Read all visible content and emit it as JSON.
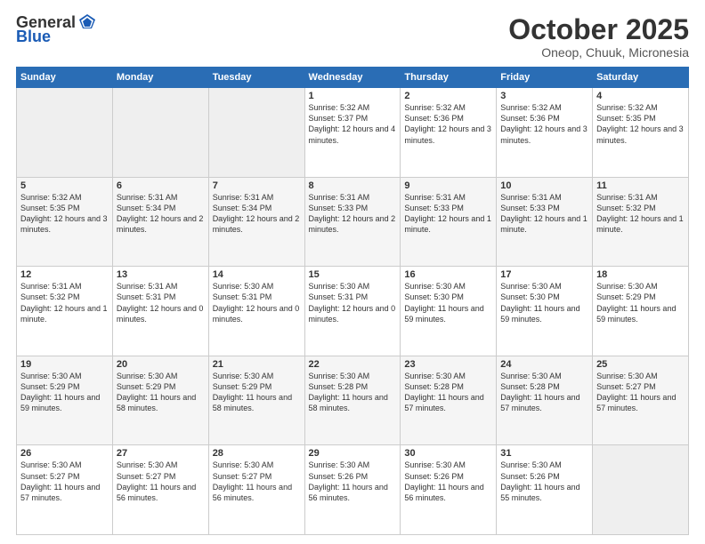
{
  "header": {
    "logo_general": "General",
    "logo_blue": "Blue",
    "month": "October 2025",
    "location": "Oneop, Chuuk, Micronesia"
  },
  "weekdays": [
    "Sunday",
    "Monday",
    "Tuesday",
    "Wednesday",
    "Thursday",
    "Friday",
    "Saturday"
  ],
  "weeks": [
    [
      {
        "day": "",
        "sunrise": "",
        "sunset": "",
        "daylight": ""
      },
      {
        "day": "",
        "sunrise": "",
        "sunset": "",
        "daylight": ""
      },
      {
        "day": "",
        "sunrise": "",
        "sunset": "",
        "daylight": ""
      },
      {
        "day": "1",
        "sunrise": "Sunrise: 5:32 AM",
        "sunset": "Sunset: 5:37 PM",
        "daylight": "Daylight: 12 hours and 4 minutes."
      },
      {
        "day": "2",
        "sunrise": "Sunrise: 5:32 AM",
        "sunset": "Sunset: 5:36 PM",
        "daylight": "Daylight: 12 hours and 3 minutes."
      },
      {
        "day": "3",
        "sunrise": "Sunrise: 5:32 AM",
        "sunset": "Sunset: 5:36 PM",
        "daylight": "Daylight: 12 hours and 3 minutes."
      },
      {
        "day": "4",
        "sunrise": "Sunrise: 5:32 AM",
        "sunset": "Sunset: 5:35 PM",
        "daylight": "Daylight: 12 hours and 3 minutes."
      }
    ],
    [
      {
        "day": "5",
        "sunrise": "Sunrise: 5:32 AM",
        "sunset": "Sunset: 5:35 PM",
        "daylight": "Daylight: 12 hours and 3 minutes."
      },
      {
        "day": "6",
        "sunrise": "Sunrise: 5:31 AM",
        "sunset": "Sunset: 5:34 PM",
        "daylight": "Daylight: 12 hours and 2 minutes."
      },
      {
        "day": "7",
        "sunrise": "Sunrise: 5:31 AM",
        "sunset": "Sunset: 5:34 PM",
        "daylight": "Daylight: 12 hours and 2 minutes."
      },
      {
        "day": "8",
        "sunrise": "Sunrise: 5:31 AM",
        "sunset": "Sunset: 5:33 PM",
        "daylight": "Daylight: 12 hours and 2 minutes."
      },
      {
        "day": "9",
        "sunrise": "Sunrise: 5:31 AM",
        "sunset": "Sunset: 5:33 PM",
        "daylight": "Daylight: 12 hours and 1 minute."
      },
      {
        "day": "10",
        "sunrise": "Sunrise: 5:31 AM",
        "sunset": "Sunset: 5:33 PM",
        "daylight": "Daylight: 12 hours and 1 minute."
      },
      {
        "day": "11",
        "sunrise": "Sunrise: 5:31 AM",
        "sunset": "Sunset: 5:32 PM",
        "daylight": "Daylight: 12 hours and 1 minute."
      }
    ],
    [
      {
        "day": "12",
        "sunrise": "Sunrise: 5:31 AM",
        "sunset": "Sunset: 5:32 PM",
        "daylight": "Daylight: 12 hours and 1 minute."
      },
      {
        "day": "13",
        "sunrise": "Sunrise: 5:31 AM",
        "sunset": "Sunset: 5:31 PM",
        "daylight": "Daylight: 12 hours and 0 minutes."
      },
      {
        "day": "14",
        "sunrise": "Sunrise: 5:30 AM",
        "sunset": "Sunset: 5:31 PM",
        "daylight": "Daylight: 12 hours and 0 minutes."
      },
      {
        "day": "15",
        "sunrise": "Sunrise: 5:30 AM",
        "sunset": "Sunset: 5:31 PM",
        "daylight": "Daylight: 12 hours and 0 minutes."
      },
      {
        "day": "16",
        "sunrise": "Sunrise: 5:30 AM",
        "sunset": "Sunset: 5:30 PM",
        "daylight": "Daylight: 11 hours and 59 minutes."
      },
      {
        "day": "17",
        "sunrise": "Sunrise: 5:30 AM",
        "sunset": "Sunset: 5:30 PM",
        "daylight": "Daylight: 11 hours and 59 minutes."
      },
      {
        "day": "18",
        "sunrise": "Sunrise: 5:30 AM",
        "sunset": "Sunset: 5:29 PM",
        "daylight": "Daylight: 11 hours and 59 minutes."
      }
    ],
    [
      {
        "day": "19",
        "sunrise": "Sunrise: 5:30 AM",
        "sunset": "Sunset: 5:29 PM",
        "daylight": "Daylight: 11 hours and 59 minutes."
      },
      {
        "day": "20",
        "sunrise": "Sunrise: 5:30 AM",
        "sunset": "Sunset: 5:29 PM",
        "daylight": "Daylight: 11 hours and 58 minutes."
      },
      {
        "day": "21",
        "sunrise": "Sunrise: 5:30 AM",
        "sunset": "Sunset: 5:29 PM",
        "daylight": "Daylight: 11 hours and 58 minutes."
      },
      {
        "day": "22",
        "sunrise": "Sunrise: 5:30 AM",
        "sunset": "Sunset: 5:28 PM",
        "daylight": "Daylight: 11 hours and 58 minutes."
      },
      {
        "day": "23",
        "sunrise": "Sunrise: 5:30 AM",
        "sunset": "Sunset: 5:28 PM",
        "daylight": "Daylight: 11 hours and 57 minutes."
      },
      {
        "day": "24",
        "sunrise": "Sunrise: 5:30 AM",
        "sunset": "Sunset: 5:28 PM",
        "daylight": "Daylight: 11 hours and 57 minutes."
      },
      {
        "day": "25",
        "sunrise": "Sunrise: 5:30 AM",
        "sunset": "Sunset: 5:27 PM",
        "daylight": "Daylight: 11 hours and 57 minutes."
      }
    ],
    [
      {
        "day": "26",
        "sunrise": "Sunrise: 5:30 AM",
        "sunset": "Sunset: 5:27 PM",
        "daylight": "Daylight: 11 hours and 57 minutes."
      },
      {
        "day": "27",
        "sunrise": "Sunrise: 5:30 AM",
        "sunset": "Sunset: 5:27 PM",
        "daylight": "Daylight: 11 hours and 56 minutes."
      },
      {
        "day": "28",
        "sunrise": "Sunrise: 5:30 AM",
        "sunset": "Sunset: 5:27 PM",
        "daylight": "Daylight: 11 hours and 56 minutes."
      },
      {
        "day": "29",
        "sunrise": "Sunrise: 5:30 AM",
        "sunset": "Sunset: 5:26 PM",
        "daylight": "Daylight: 11 hours and 56 minutes."
      },
      {
        "day": "30",
        "sunrise": "Sunrise: 5:30 AM",
        "sunset": "Sunset: 5:26 PM",
        "daylight": "Daylight: 11 hours and 56 minutes."
      },
      {
        "day": "31",
        "sunrise": "Sunrise: 5:30 AM",
        "sunset": "Sunset: 5:26 PM",
        "daylight": "Daylight: 11 hours and 55 minutes."
      },
      {
        "day": "",
        "sunrise": "",
        "sunset": "",
        "daylight": ""
      }
    ]
  ]
}
